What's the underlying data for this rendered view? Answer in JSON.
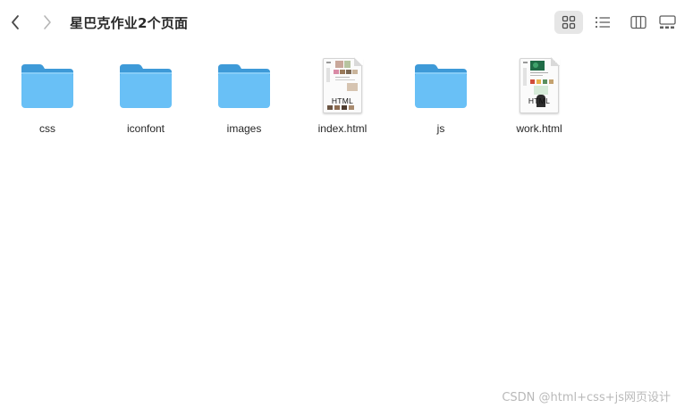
{
  "window": {
    "title": "星巴克作业2个页面"
  },
  "toolbar": {
    "back_icon": "chevron-left-icon",
    "forward_icon": "chevron-right-icon",
    "view_modes": [
      "icon-view-icon",
      "list-view-icon",
      "column-view-icon",
      "gallery-view-icon"
    ],
    "active_view": "icon-view-icon"
  },
  "files": [
    {
      "name": "css",
      "kind": "folder"
    },
    {
      "name": "iconfont",
      "kind": "folder"
    },
    {
      "name": "images",
      "kind": "folder"
    },
    {
      "name": "index.html",
      "kind": "html",
      "badge": "HTML"
    },
    {
      "name": "js",
      "kind": "folder"
    },
    {
      "name": "work.html",
      "kind": "html",
      "badge": "HTML"
    }
  ],
  "colors": {
    "folder_back": "#3e9ad8",
    "folder_front": "#69c0f6",
    "active_view_bg": "#e6e6e6",
    "icon_gray": "#5f5f5f"
  },
  "watermark": {
    "text": "CSDN @html+css+js网页设计"
  }
}
